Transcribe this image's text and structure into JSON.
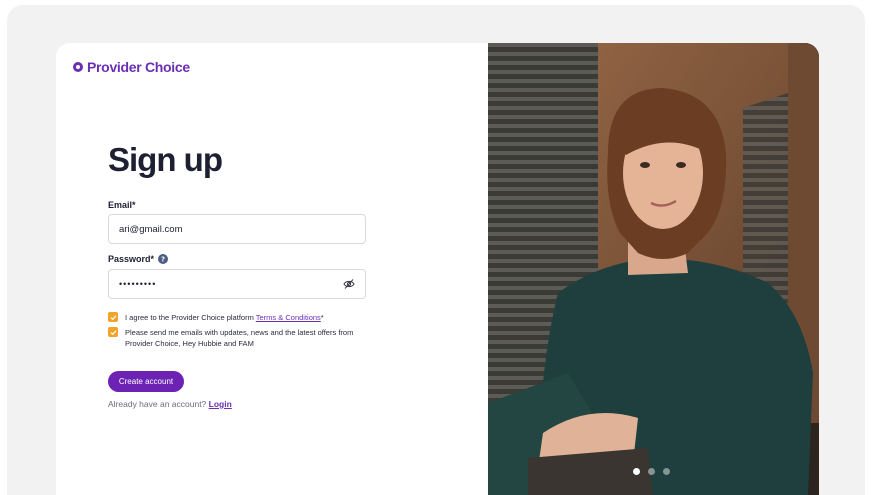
{
  "brand": {
    "name": "Provider Choice",
    "color": "#6b2fb5"
  },
  "form": {
    "title": "Sign up",
    "email_label": "Email*",
    "email_value": "ari@gmail.com",
    "password_label": "Password*",
    "password_value": "•••••••••",
    "terms_prefix": "I agree to the Provider Choice platform ",
    "terms_link": "Terms & Conditions",
    "terms_suffix": "*",
    "marketing_text": "Please send me emails with updates, news and the latest offers from Provider Choice, Hey Hubbie and FAM",
    "submit_label": "Create account",
    "already_text": "Already have an account? ",
    "login_link": "Login"
  },
  "carousel": {
    "slide_count": 3,
    "active_index": 0
  },
  "icons": {
    "logo": "provider-choice-logo-icon",
    "help": "help-icon",
    "eye": "eye-slash-icon",
    "check": "check-icon"
  },
  "colors": {
    "accent": "#6c22b3",
    "checkbox": "#f0a52a"
  }
}
